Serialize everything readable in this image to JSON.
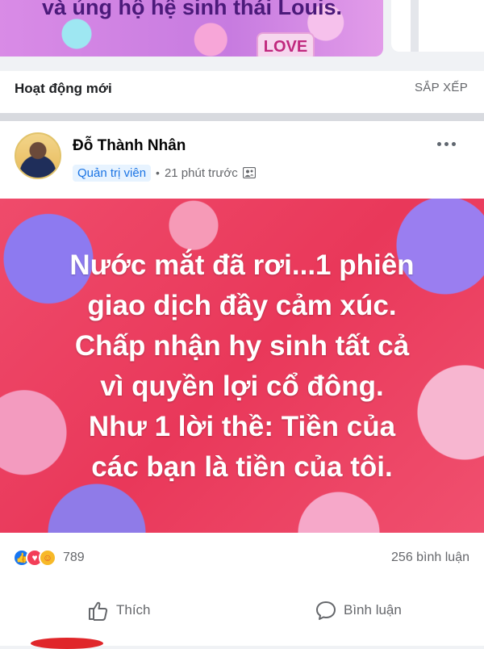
{
  "top_banner": {
    "text": "và ủng hộ hệ sinh thái Louis.",
    "badge": "LOVE"
  },
  "section": {
    "title": "Hoạt động mới",
    "sort_label": "SẮP XẾP"
  },
  "post": {
    "author": "Đỗ Thành Nhân",
    "role": "Quản trị viên",
    "time": "21 phút trước",
    "separator": "•",
    "privacy_icon": "group-icon",
    "image_text": "Nước mắt đã rơi...1 phiên giao dịch đầy cảm xúc. Chấp nhận hy sinh tất cả vì quyền lợi cổ đông. Như 1 lời thề: Tiền của các bạn là tiền của tôi.",
    "image_lines": [
      "Nước mắt đã rơi...1 phiên",
      "giao dịch đầy cảm xúc.",
      "Chấp nhận hy sinh tất cả",
      "vì quyền lợi cổ đông.",
      "Như 1 lời thề: Tiền của",
      "các bạn là tiền của tôi."
    ],
    "reaction_count": "789",
    "comment_count": "256 bình luận",
    "like_label": "Thích",
    "comment_label": "Bình luận"
  },
  "colors": {
    "accent": "#1877f2",
    "post_background": "#e9385a",
    "muted_text": "#65676b"
  }
}
